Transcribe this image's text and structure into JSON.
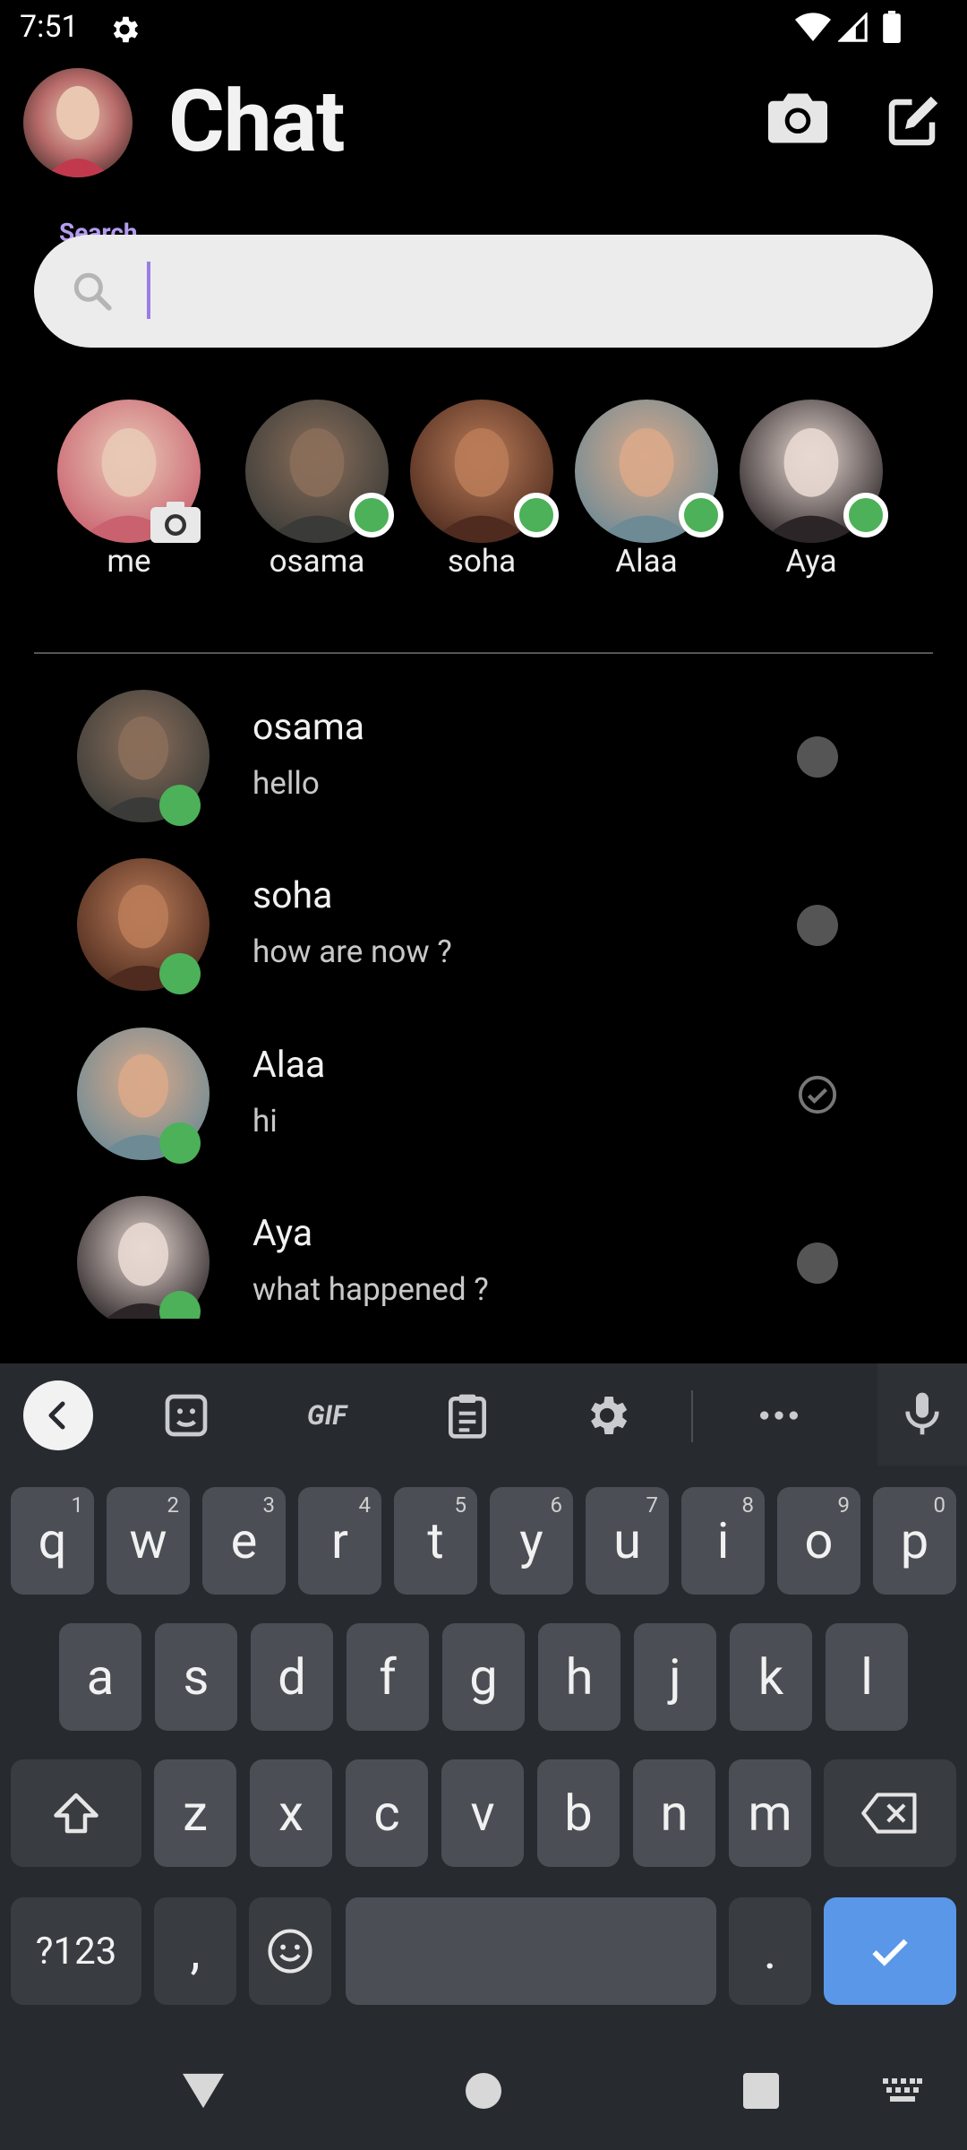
{
  "status_bar": {
    "time": "7:51"
  },
  "header": {
    "title": "Chat"
  },
  "search": {
    "label": "Search",
    "value": "",
    "placeholder": ""
  },
  "stories": [
    {
      "name": "me",
      "online": false,
      "colors": [
        "#c9616f",
        "#e9c9b6"
      ]
    },
    {
      "name": "osama",
      "online": true,
      "colors": [
        "#3a3b38",
        "#8a6e5a"
      ]
    },
    {
      "name": "soha",
      "online": true,
      "colors": [
        "#4e2b1e",
        "#b97b58"
      ]
    },
    {
      "name": "Alaa",
      "online": true,
      "colors": [
        "#6d8a95",
        "#d9a98a"
      ]
    },
    {
      "name": "Aya",
      "online": true,
      "colors": [
        "#2b2527",
        "#e8d8d2"
      ]
    }
  ],
  "chats": [
    {
      "name": "osama",
      "message": "hello",
      "status": "unread"
    },
    {
      "name": "soha",
      "message": "how are now ?",
      "status": "unread"
    },
    {
      "name": "Alaa",
      "message": "hi",
      "status": "read"
    },
    {
      "name": "Aya",
      "message": "what happened ?",
      "status": "unread"
    }
  ],
  "keyboard": {
    "toolbar": {
      "gif_label": "GIF"
    },
    "row1": [
      {
        "k": "q",
        "h": "1"
      },
      {
        "k": "w",
        "h": "2"
      },
      {
        "k": "e",
        "h": "3"
      },
      {
        "k": "r",
        "h": "4"
      },
      {
        "k": "t",
        "h": "5"
      },
      {
        "k": "y",
        "h": "6"
      },
      {
        "k": "u",
        "h": "7"
      },
      {
        "k": "i",
        "h": "8"
      },
      {
        "k": "o",
        "h": "9"
      },
      {
        "k": "p",
        "h": "0"
      }
    ],
    "row2": [
      "a",
      "s",
      "d",
      "f",
      "g",
      "h",
      "j",
      "k",
      "l"
    ],
    "row3": [
      "z",
      "x",
      "c",
      "v",
      "b",
      "n",
      "m"
    ],
    "symbols_label": "?123",
    "comma": ",",
    "period": "."
  },
  "colors": {
    "accent": "#9b7be6",
    "online": "#4cb158",
    "enter_key": "#5a97e8",
    "keyboard_bg": "#272b30"
  }
}
